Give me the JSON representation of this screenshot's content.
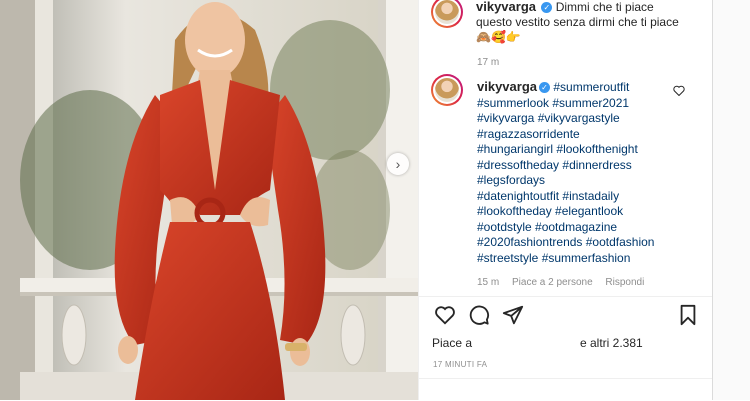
{
  "post": {
    "username": "vikyvarga",
    "caption_line1": "Dimmi che ti piace",
    "caption_line2": "questo vestito senza dirmi che ti piace",
    "caption_emojis": "🙈🥰👉",
    "caption_time": "17 m"
  },
  "comment": {
    "username": "vikyvarga",
    "hashtag_lines": [
      "#summeroutfit",
      "#summerlook #summer2021",
      "#vikyvarga #vikyvargastyle",
      "#ragazzasorridente",
      "#hungariangirl #lookofthenight",
      "#dressoftheday #dinnerdress",
      "#legsfordays",
      "#datenightoutfit #instadaily",
      "#lookoftheday #elegantlook",
      "#ootdstyle #ootdmagazine",
      "#2020fashiontrends #ootdfashion",
      "#streetstyle #summerfashion"
    ],
    "time": "15 m",
    "likes": "Piace a 2 persone",
    "reply": "Rispondi"
  },
  "likes_prefix": "Piace a",
  "likes_suffix": "e altri 2.381",
  "post_time": "17 MINUTI FA",
  "icons": {
    "like": "heart-icon",
    "comment": "comment-icon",
    "share": "send-icon",
    "save": "bookmark-icon",
    "next": "chevron-right-icon"
  },
  "colors": {
    "hashtag": "#00376b",
    "verified": "#3897f0",
    "dress": "#c9361e"
  }
}
